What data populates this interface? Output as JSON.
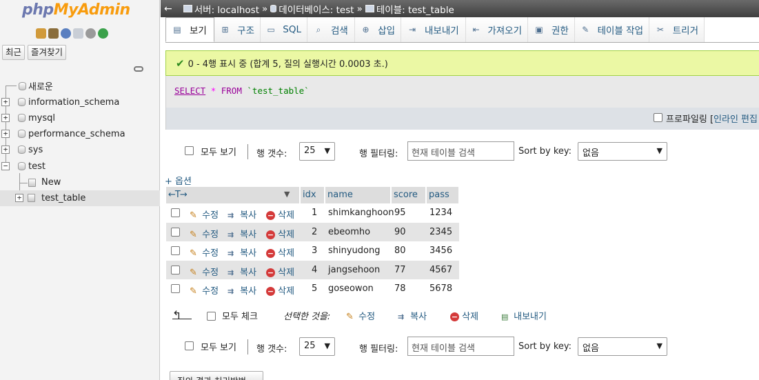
{
  "logo": {
    "php": "php",
    "myadmin": "MyAdmin"
  },
  "nav": {
    "icons": [
      "home-icon",
      "database-icon",
      "help-icon",
      "docs-icon",
      "settings-icon",
      "reload-icon"
    ],
    "recent_label": "최근",
    "favorites_label": "즐겨찾기",
    "tree": [
      {
        "label": "새로운",
        "toggle": ""
      },
      {
        "label": "information_schema",
        "toggle": "+"
      },
      {
        "label": "mysql",
        "toggle": "+"
      },
      {
        "label": "performance_schema",
        "toggle": "+"
      },
      {
        "label": "sys",
        "toggle": "+"
      },
      {
        "label": "test",
        "toggle": "−"
      },
      {
        "label": "New",
        "toggle": ""
      },
      {
        "label": "test_table",
        "toggle": "+"
      }
    ]
  },
  "breadcrumb": {
    "server": "서버: localhost",
    "database": "데이터베이스: test",
    "table": "테이블: test_table",
    "separator": "»"
  },
  "tabs": [
    {
      "label": "보기",
      "icon": "browse-icon",
      "glyph": "▤"
    },
    {
      "label": "구조",
      "icon": "structure-icon",
      "glyph": "⊞"
    },
    {
      "label": "SQL",
      "icon": "sql-icon",
      "glyph": "▭"
    },
    {
      "label": "검색",
      "icon": "search-icon",
      "glyph": "⌕"
    },
    {
      "label": "삽입",
      "icon": "insert-icon",
      "glyph": "⊕"
    },
    {
      "label": "내보내기",
      "icon": "export-icon",
      "glyph": "⇥"
    },
    {
      "label": "가져오기",
      "icon": "import-icon",
      "glyph": "⇤"
    },
    {
      "label": "권한",
      "icon": "privileges-icon",
      "glyph": "▣"
    },
    {
      "label": "테이블 작업",
      "icon": "operations-icon",
      "glyph": "✎"
    },
    {
      "label": "트리거",
      "icon": "triggers-icon",
      "glyph": "✂"
    }
  ],
  "success_message": "0 - 4행 표시 중 (합계 5, 질의 실행시간 0.0003 초.)",
  "sql": {
    "select": "SELECT",
    "star": "*",
    "from": "FROM",
    "table": "`test_table`"
  },
  "profiling": {
    "label": "프로파일링",
    "bracket": "[",
    "link": "인라인 편집"
  },
  "filter": {
    "select_all": "모두 보기",
    "row_count_label": "행 갯수:",
    "row_count_value": "25",
    "row_filter_label": "행 필터링:",
    "row_filter_placeholder": "현재 테이블 검색",
    "sort_label": "Sort by key:",
    "sort_value": "없음"
  },
  "options_link": "+ 옵션",
  "results": {
    "columns": [
      "idx",
      "name",
      "score",
      "pass"
    ],
    "actions": {
      "edit": "수정",
      "copy": "복사",
      "delete": "삭제"
    },
    "rows": [
      {
        "idx": "1",
        "name": "shimkanghoon",
        "score": "95",
        "pass": "1234"
      },
      {
        "idx": "2",
        "name": "ebeomho",
        "score": "90",
        "pass": "2345"
      },
      {
        "idx": "3",
        "name": "shinyudong",
        "score": "80",
        "pass": "3456"
      },
      {
        "idx": "4",
        "name": "jangsehoon",
        "score": "77",
        "pass": "4567"
      },
      {
        "idx": "5",
        "name": "goseowon",
        "score": "78",
        "pass": "5678"
      }
    ]
  },
  "bulk": {
    "check_all": "모두 체크",
    "with_selected": "선택한 것을:",
    "edit": "수정",
    "copy": "복사",
    "delete": "삭제",
    "export": "내보내기"
  },
  "bottom_button": "질의 결과 처리방법"
}
